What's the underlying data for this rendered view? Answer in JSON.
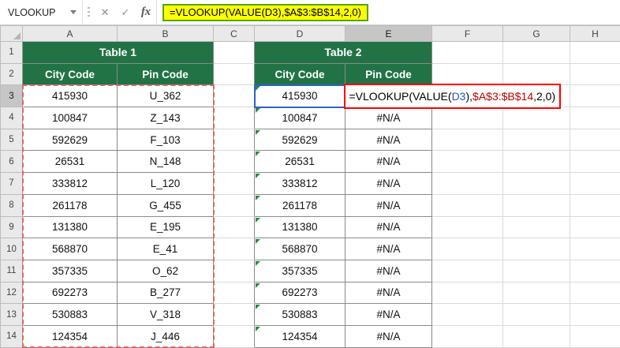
{
  "name_box": {
    "value": "VLOOKUP",
    "dropdown_icon": "▼"
  },
  "formula_bar": {
    "cancel_icon": "✕",
    "enter_icon": "✓",
    "fx_label": "fx",
    "formula": "=VLOOKUP(VALUE(D3),$A$3:$B$14,2,0)"
  },
  "grid": {
    "column_headers": [
      "A",
      "B",
      "C",
      "D",
      "E",
      "F",
      "G",
      "H"
    ],
    "row_count": 14,
    "selected_column": "E",
    "selected_row": 3
  },
  "table1": {
    "title": "Table 1",
    "col_city": "City Code",
    "col_pin": "Pin Code",
    "rows": [
      {
        "city": "415930",
        "pin": "U_362"
      },
      {
        "city": "100847",
        "pin": "Z_143"
      },
      {
        "city": "592629",
        "pin": "F_103"
      },
      {
        "city": "26531",
        "pin": "N_148"
      },
      {
        "city": "333812",
        "pin": "L_120"
      },
      {
        "city": "261178",
        "pin": "G_455"
      },
      {
        "city": "131380",
        "pin": "E_195"
      },
      {
        "city": "568870",
        "pin": "E_41"
      },
      {
        "city": "357335",
        "pin": "O_62"
      },
      {
        "city": "692273",
        "pin": "B_277"
      },
      {
        "city": "530883",
        "pin": "V_318"
      },
      {
        "city": "124354",
        "pin": "J_446"
      }
    ]
  },
  "table2": {
    "title": "Table 2",
    "col_city": "City Code",
    "col_pin": "Pin Code",
    "rows": [
      {
        "city": "415930",
        "pin": ""
      },
      {
        "city": "100847",
        "pin": "#N/A"
      },
      {
        "city": "592629",
        "pin": "#N/A"
      },
      {
        "city": "26531",
        "pin": "#N/A"
      },
      {
        "city": "333812",
        "pin": "#N/A"
      },
      {
        "city": "261178",
        "pin": "#N/A"
      },
      {
        "city": "131380",
        "pin": "#N/A"
      },
      {
        "city": "568870",
        "pin": "#N/A"
      },
      {
        "city": "357335",
        "pin": "#N/A"
      },
      {
        "city": "692273",
        "pin": "#N/A"
      },
      {
        "city": "530883",
        "pin": "#N/A"
      },
      {
        "city": "124354",
        "pin": "#N/A"
      }
    ]
  },
  "active_cell": {
    "ref": "E3",
    "referenced_cell": "D3",
    "referenced_range": "A3:B14",
    "formula_parts": [
      {
        "text": "=VLOOKUP(VALUE(",
        "color": "#000000"
      },
      {
        "text": "D3",
        "color": "#2358C5"
      },
      {
        "text": "),",
        "color": "#000000"
      },
      {
        "text": "$A$3:$B$14",
        "color": "#C00000"
      },
      {
        "text": ",2,0)",
        "color": "#000000"
      }
    ]
  },
  "colors": {
    "table_header_green": "#217346",
    "formula_highlight_bg": "#FFFF00",
    "formula_highlight_border": "#55A519",
    "range_reference_border": "#E06666",
    "cell_reference_border": "#3060C8",
    "annotation_border": "#FF0000",
    "error_indicator_green": "#1E8F3E"
  }
}
